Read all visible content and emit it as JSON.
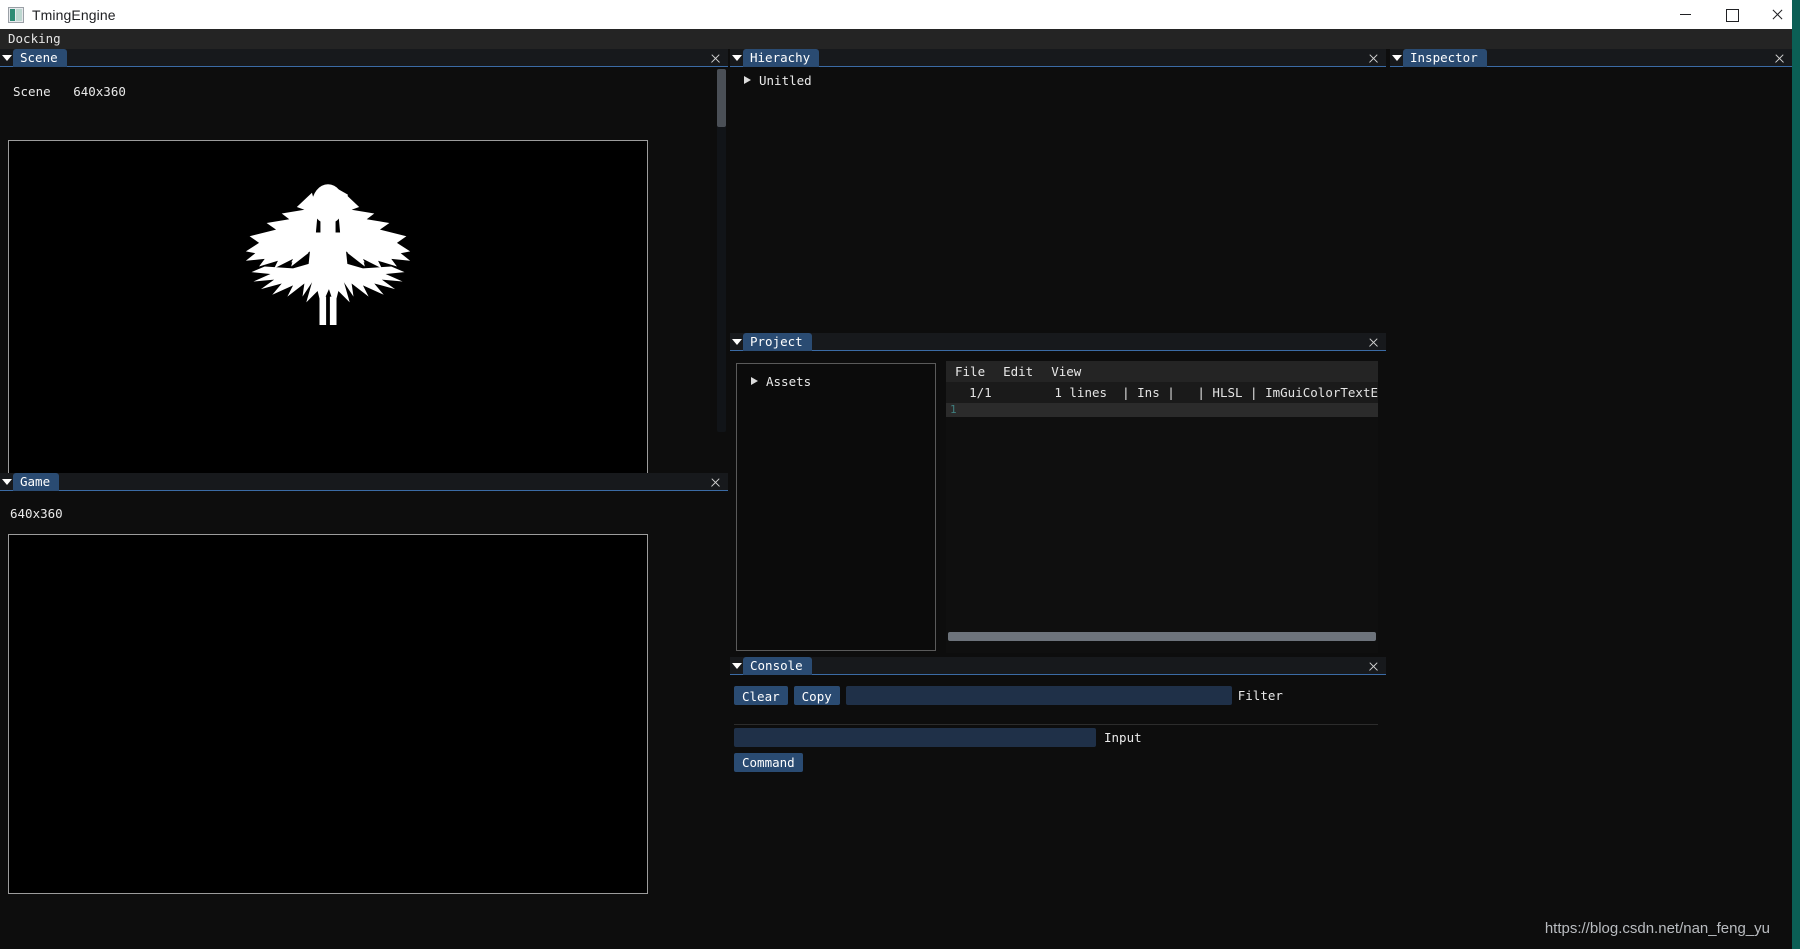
{
  "window": {
    "title": "TmingEngine",
    "icon": "app-icon",
    "controls": {
      "minimize": "minimize",
      "maximize": "maximize",
      "close": "close"
    },
    "accent_color": "#0b5f55"
  },
  "menubar": {
    "items": [
      {
        "label": "Docking"
      }
    ]
  },
  "panels": {
    "scene": {
      "tab_label": "Scene",
      "content_label": "Scene   640x360",
      "viewport_size": "640x360",
      "sprite": "angel-winged-figure-silhouette",
      "close_label": "close"
    },
    "game": {
      "tab_label": "Game",
      "content_label": "640x360",
      "viewport_size": "640x360",
      "close_label": "close"
    },
    "hierarchy": {
      "tab_label": "Hierachy",
      "close_label": "close",
      "tree": [
        {
          "label": "Unitled",
          "expanded": false
        }
      ]
    },
    "project": {
      "tab_label": "Project",
      "close_label": "close",
      "tree": [
        {
          "label": "Assets",
          "expanded": false
        }
      ],
      "editor": {
        "menu": [
          {
            "label": "File"
          },
          {
            "label": "Edit"
          },
          {
            "label": "View"
          }
        ],
        "status": {
          "position": "1/1",
          "lines": "1 lines",
          "mode": "Ins",
          "language": "HLSL",
          "filename": "ImGuiColorTextE"
        },
        "line_numbers": [
          "1"
        ]
      }
    },
    "console": {
      "tab_label": "Console",
      "close_label": "close",
      "clear_label": "Clear",
      "copy_label": "Copy",
      "filter_label": "Filter",
      "filter_value": "",
      "input_label": "Input",
      "input_value": "",
      "command_label": "Command"
    },
    "inspector": {
      "tab_label": "Inspector",
      "close_label": "close"
    }
  },
  "watermark": {
    "text": "https://blog.csdn.net/nan_feng_yu"
  }
}
